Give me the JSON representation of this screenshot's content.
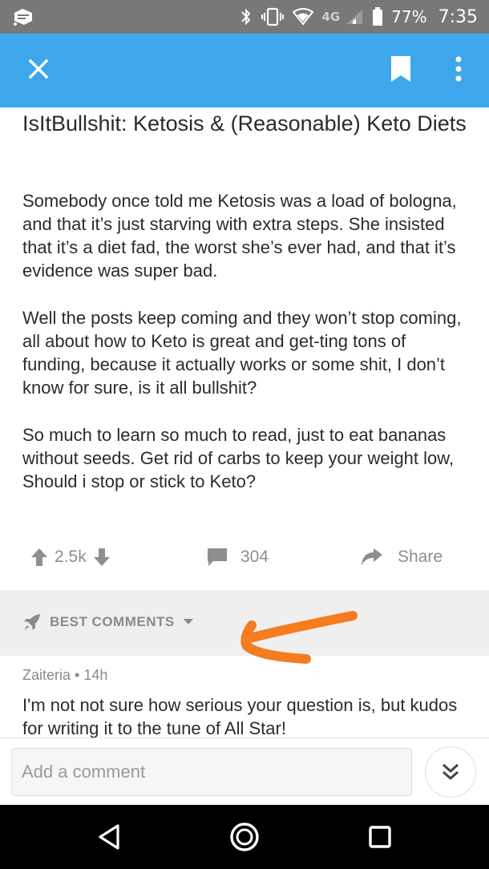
{
  "status_bar": {
    "network_label": "4G",
    "battery_percent": "77%",
    "time": "7:35",
    "icons": [
      "notification-icon",
      "bluetooth-icon",
      "vibrate-icon",
      "wifi-icon",
      "signal-icon",
      "battery-icon"
    ]
  },
  "app_bar": {
    "color": "#3ea7ec",
    "icons": [
      "close-icon",
      "bookmark-icon",
      "more-vert-icon"
    ]
  },
  "post": {
    "title": "IsItBullshit: Ketosis & (Reasonable) Keto Diets",
    "paragraphs": [
      "Somebody once told me Ketosis was a load of bologna, and that it’s just starving with extra steps. She insisted that it’s a diet fad, the worst she’s ever had, and that it’s evidence was super bad.",
      "Well the posts keep coming and they won’t stop coming, all about how to Keto is great and get-ting tons of funding, because it actually works or some shit, I don’t know for sure, is it all bullshit?",
      "So much to learn so much to read, just to eat bananas without seeds. Get rid of carbs to keep your weight low, Should i stop or stick to Keto?"
    ],
    "score": "2.5k",
    "comment_count": "304",
    "share_label": "Share"
  },
  "comments_section": {
    "sort_label": "BEST COMMENTS",
    "annotation_color": "#f57c1f",
    "comments": [
      {
        "author": "Zaiteria",
        "age": "14h",
        "separator": "•",
        "text": "I'm not not sure how serious your question is, but kudos for writing it to the tune of All Star!"
      }
    ]
  },
  "comment_bar": {
    "placeholder": "Add a comment"
  },
  "nav_bar": {
    "icons": [
      "back-icon",
      "home-icon",
      "recents-icon"
    ]
  }
}
